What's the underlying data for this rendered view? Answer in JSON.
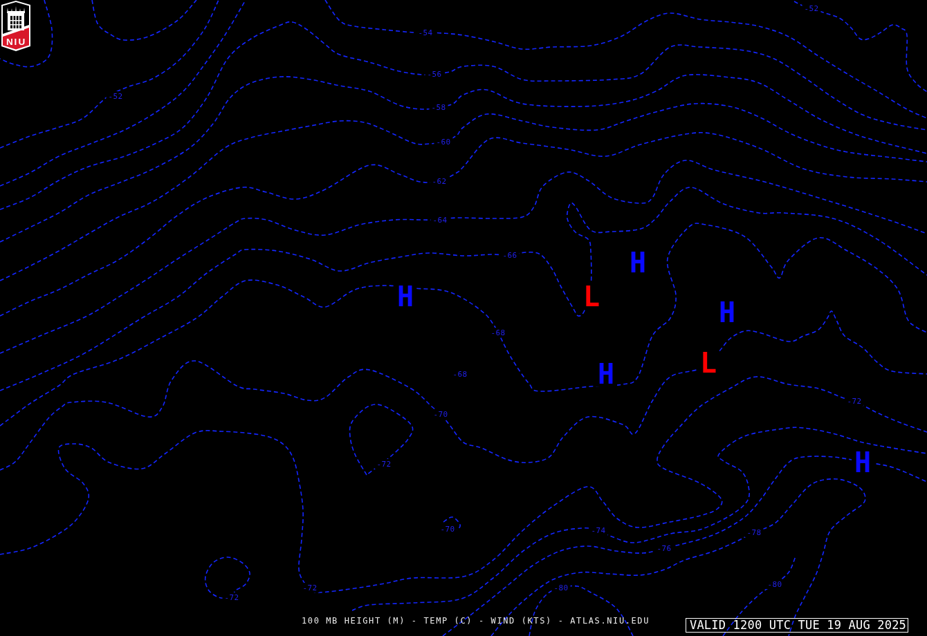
{
  "logo": {
    "text": "NIU"
  },
  "contour_labels": [
    {
      "text": "-52"
    },
    {
      "text": "-54"
    },
    {
      "text": "-56"
    },
    {
      "text": "-52"
    },
    {
      "text": "-58"
    },
    {
      "text": "-60"
    },
    {
      "text": "-62"
    },
    {
      "text": "-64"
    },
    {
      "text": "-66"
    },
    {
      "text": "-68"
    },
    {
      "text": "-68"
    },
    {
      "text": "-72"
    },
    {
      "text": "-70"
    },
    {
      "text": "-72"
    },
    {
      "text": "-70"
    },
    {
      "text": "-74"
    },
    {
      "text": "-78"
    },
    {
      "text": "-76"
    },
    {
      "text": "-80"
    },
    {
      "text": "-72"
    },
    {
      "text": "-80"
    },
    {
      "text": "-72"
    }
  ],
  "pressure_centers": [
    {
      "kind": "high",
      "letter": "H"
    },
    {
      "kind": "high",
      "letter": "H"
    },
    {
      "kind": "low",
      "letter": "L"
    },
    {
      "kind": "high",
      "letter": "H"
    },
    {
      "kind": "low",
      "letter": "L"
    },
    {
      "kind": "high",
      "letter": "H"
    },
    {
      "kind": "high",
      "letter": "H"
    }
  ],
  "footer": {
    "caption": "100 MB HEIGHT (M) - TEMP (C) - WIND (KTS) - ATLAS.NIU.EDU",
    "valid_time": "VALID 1200 UTC TUE 19 AUG 2025"
  }
}
